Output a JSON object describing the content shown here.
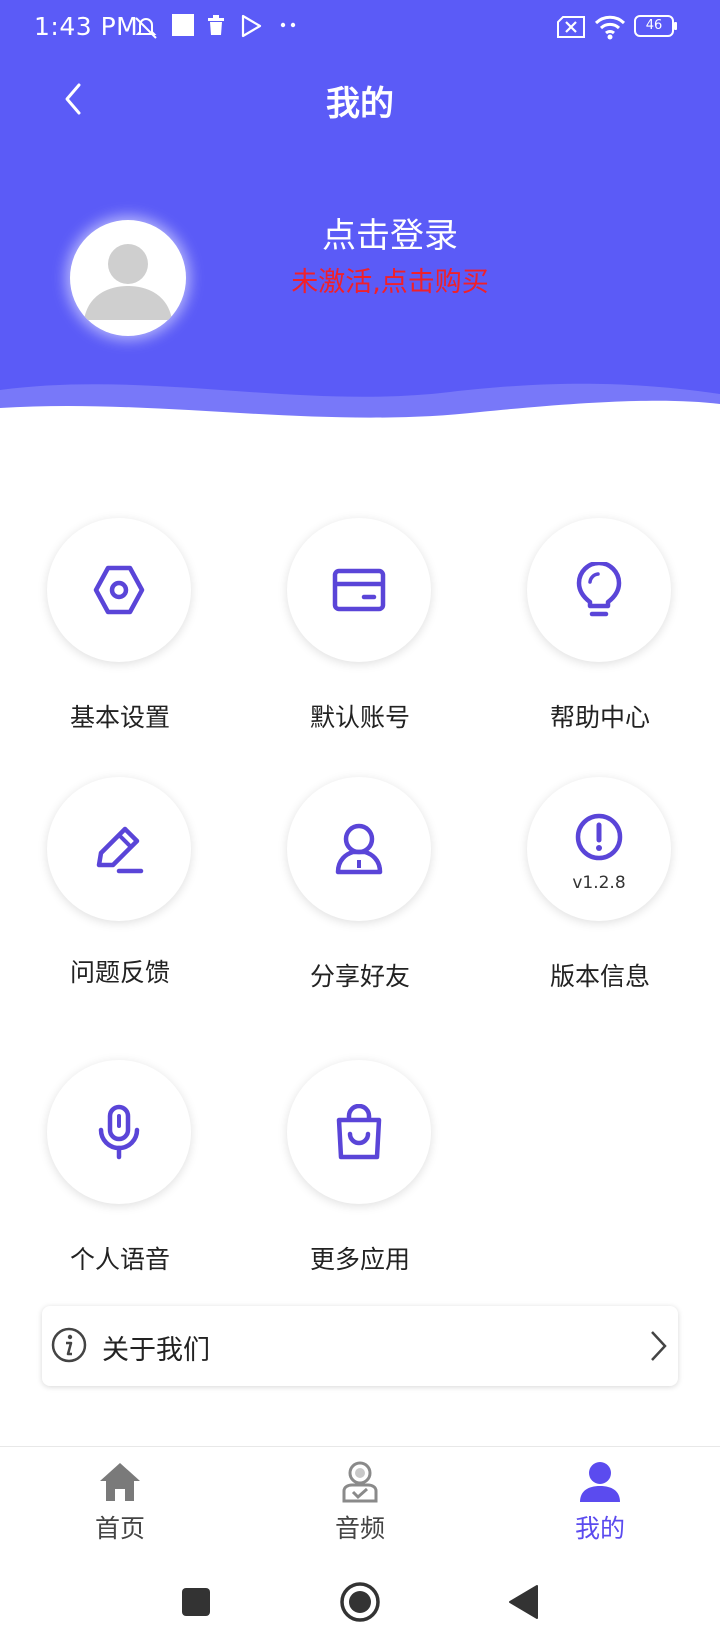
{
  "status_bar": {
    "time": "1:43 PM",
    "battery": "46"
  },
  "header": {
    "title": "我的",
    "login_text": "点击登录",
    "activate_text": "未激活,点击购买"
  },
  "colors": {
    "primary": "#5b5bf7",
    "icon_purple": "#5a45d8",
    "activate_red": "#f0202a",
    "nav_inactive": "#7a7a7a"
  },
  "grid": {
    "items": [
      {
        "label": "基本设置",
        "icon": "settings-hex-icon"
      },
      {
        "label": "默认账号",
        "icon": "card-icon"
      },
      {
        "label": "帮助中心",
        "icon": "lightbulb-icon"
      },
      {
        "label": "问题反馈",
        "icon": "pencil-icon"
      },
      {
        "label": "分享好友",
        "icon": "person-icon"
      },
      {
        "label": "版本信息",
        "icon": "exclamation-icon",
        "version": "v1.2.8"
      },
      {
        "label": "个人语音",
        "icon": "microphone-icon"
      },
      {
        "label": "更多应用",
        "icon": "shopping-bag-icon"
      }
    ]
  },
  "about": {
    "label": "关于我们"
  },
  "bottom_nav": {
    "items": [
      {
        "label": "首页",
        "icon": "home-icon",
        "active": false
      },
      {
        "label": "音频",
        "icon": "audio-person-icon",
        "active": false
      },
      {
        "label": "我的",
        "icon": "user-icon",
        "active": true
      }
    ]
  }
}
